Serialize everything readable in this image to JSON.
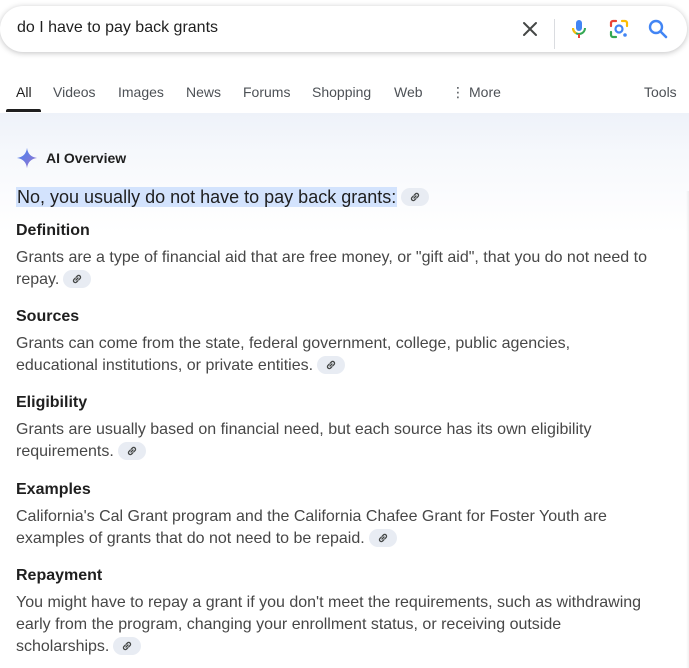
{
  "search": {
    "query": "do I have to pay back grants"
  },
  "tabs": [
    {
      "label": "All",
      "active": true
    },
    {
      "label": "Videos"
    },
    {
      "label": "Images"
    },
    {
      "label": "News"
    },
    {
      "label": "Forums"
    },
    {
      "label": "Shopping"
    },
    {
      "label": "Web"
    },
    {
      "label": "More"
    }
  ],
  "tools_label": "Tools",
  "overview": {
    "title": "AI Overview",
    "lead": "No, you usually do not have to pay back grants:",
    "sections": [
      {
        "title": "Definition",
        "body": "Grants are a type of financial aid that are free money, or \"gift aid\", that you do not need to repay."
      },
      {
        "title": "Sources",
        "body": "Grants can come from the state, federal government, college, public agencies, educational institutions, or private entities."
      },
      {
        "title": "Eligibility",
        "body": "Grants are usually based on financial need, but each source has its own eligibility requirements."
      },
      {
        "title": "Examples",
        "body": "California's Cal Grant program and the California Chafee Grant for Foster Youth are examples of grants that do not need to be repaid."
      },
      {
        "title": "Repayment",
        "body": "You might have to repay a grant if you don't meet the requirements, such as withdrawing early from the program, changing your enrollment status, or receiving outside scholarships."
      }
    ]
  },
  "icons": {
    "clear": "close-icon",
    "mic": "microphone-icon",
    "lens": "google-lens-icon",
    "search": "search-icon",
    "sparkle": "sparkle-icon",
    "link": "link-icon"
  },
  "colors": {
    "highlight": "#d3e3fd",
    "accent_blue": "#4285f4",
    "chip_bg": "#e8ecf3"
  }
}
